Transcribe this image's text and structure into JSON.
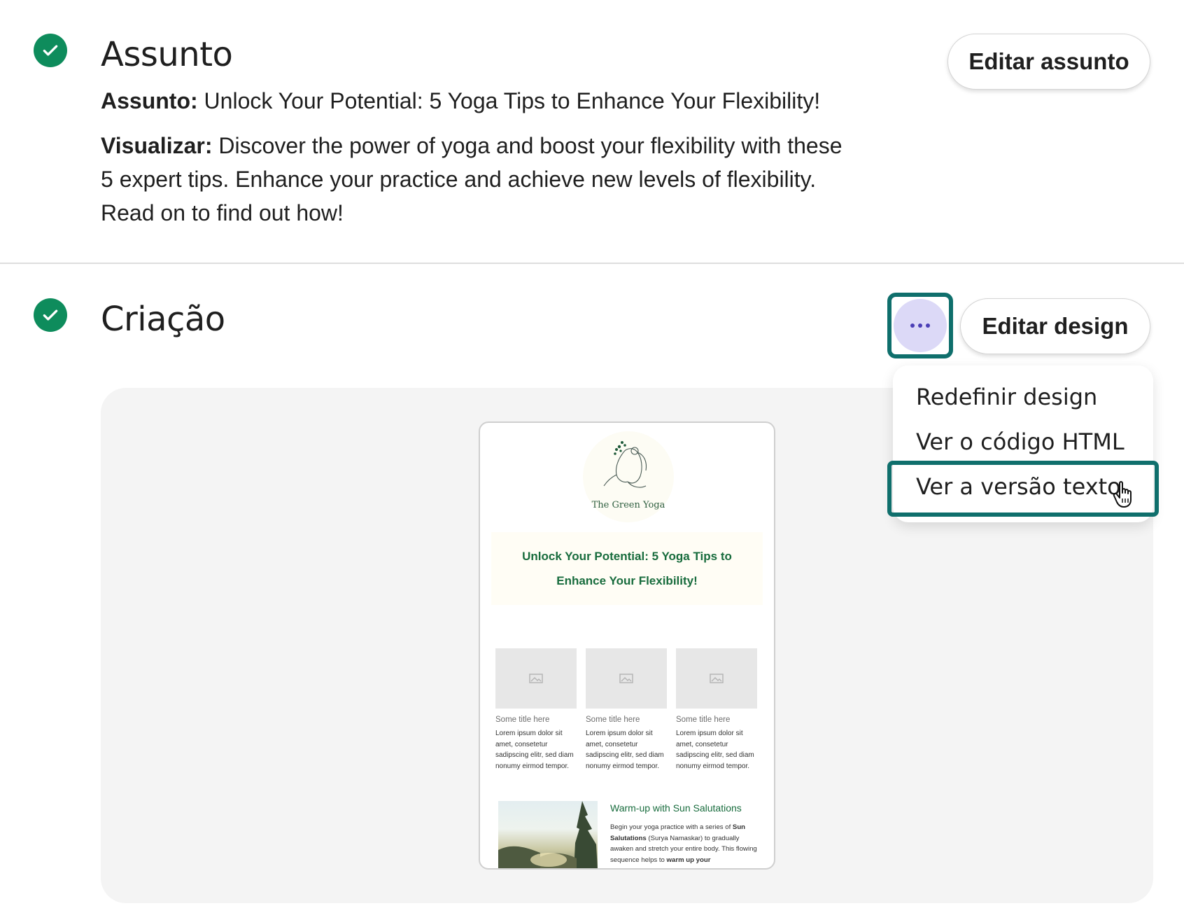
{
  "subject_section": {
    "title": "Assunto",
    "edit_button": "Editar assunto",
    "subject_label": "Assunto:",
    "subject_value": "Unlock Your Potential: 5 Yoga Tips to Enhance Your Flexibility!",
    "preview_label": "Visualizar:",
    "preview_lines": [
      "Discover the power of yoga and boost your flexibility with these",
      "5 expert tips. Enhance your practice and achieve new levels of flexibility.",
      "Read on to find out how!"
    ]
  },
  "design_section": {
    "title": "Criação",
    "more_button_icon": "more-horizontal-icon",
    "edit_button": "Editar design"
  },
  "menu": {
    "items": [
      "Redefinir design",
      "Ver o código HTML",
      "Ver a versão texto"
    ],
    "highlighted_item": "Ver a versão texto"
  },
  "email_preview": {
    "logo_text": "The Green Yoga",
    "hero_title": "Unlock Your Potential: 5 Yoga Tips to Enhance Your Flexibility!",
    "columns": [
      {
        "title": "Some title here",
        "body": "Lorem ipsum dolor sit amet, consetetur sadipscing elitr, sed diam nonumy eirmod tempor."
      },
      {
        "title": "Some title here",
        "body": "Lorem ipsum dolor sit amet, consetetur sadipscing elitr, sed diam nonumy eirmod tempor."
      },
      {
        "title": "Some title here",
        "body": "Lorem ipsum dolor sit amet, consetetur sadipscing elitr, sed diam nonumy eirmod tempor."
      }
    ],
    "feature_title": "Warm-up with Sun Salutations",
    "feature_body": {
      "t1": "Begin your yoga practice with a series of ",
      "b1": "Sun Salutations",
      "t2": " (Surya Namaskar) to gradually awaken and stretch your entire body. This flowing sequence helps to ",
      "b2": "warm up your"
    }
  },
  "colors": {
    "check_green": "#0e8c5c",
    "focus_ring": "#0f6f6c",
    "more_button_bg": "#dcd9f7",
    "email_green": "#186c3d"
  }
}
